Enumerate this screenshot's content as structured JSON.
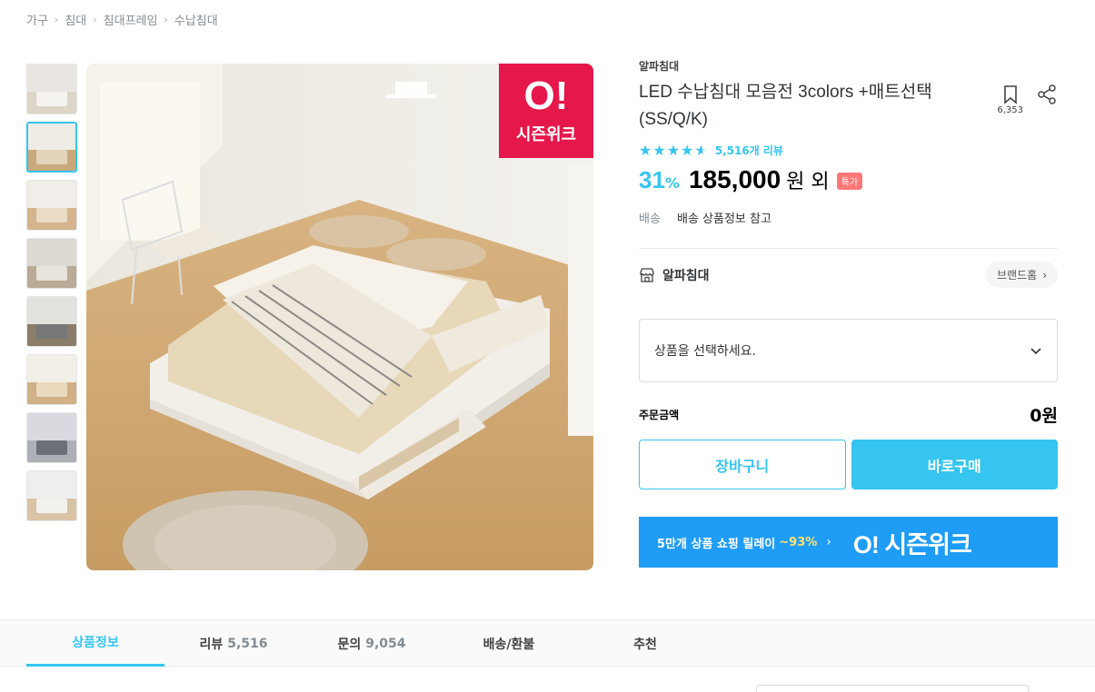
{
  "breadcrumb": [
    "가구",
    "침대",
    "침대프레임",
    "수납침대"
  ],
  "badge": {
    "big": "O!",
    "small": "시즌위크"
  },
  "product": {
    "brand": "알파침대",
    "title": "LED 수납침대 모음전 3colors +매트선택 (SS/Q/K)",
    "scrap_count": "6,353",
    "rating_stars": 4.5,
    "review_text": "5,516개 리뷰",
    "discount": "31",
    "percent_sign": "%",
    "price": "185,000",
    "price_suffix": "원 외",
    "special_badge": "특가",
    "shipping_label": "배송",
    "shipping_value": "배송 상품정보 참고"
  },
  "brand_row": {
    "name": "알파침대",
    "home_label": "브랜드홈"
  },
  "select": {
    "placeholder": "상품을 선택하세요."
  },
  "order": {
    "label": "주문금액",
    "value": "0원"
  },
  "buttons": {
    "cart": "장바구니",
    "buy": "바로구매"
  },
  "banner": {
    "text": "5만개 상품 쇼핑 릴레이",
    "percent": "~93%",
    "logo": "O! 시즌위크"
  },
  "tabs": [
    {
      "label": "상품정보",
      "count": ""
    },
    {
      "label": "리뷰",
      "count": "5,516"
    },
    {
      "label": "문의",
      "count": "9,054"
    },
    {
      "label": "배송/환불",
      "count": ""
    },
    {
      "label": "추천",
      "count": ""
    }
  ],
  "colors": {
    "accent": "#35c5f0",
    "badge_red": "#e6174a",
    "banner_blue": "#1f9cf5"
  }
}
